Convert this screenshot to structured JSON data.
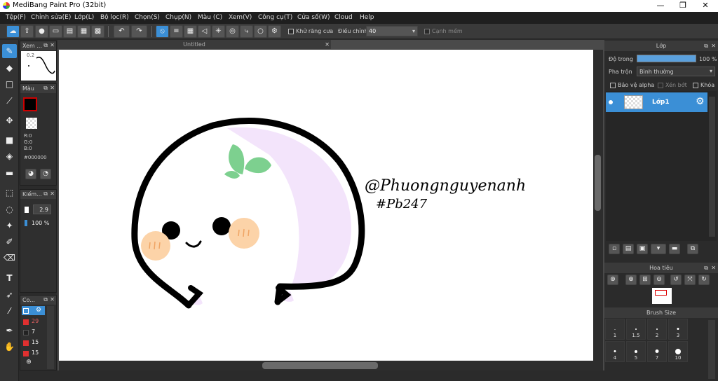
{
  "app": {
    "title": "MediBang Paint Pro (32bit)"
  },
  "window_controls": {
    "minimize": "—",
    "maximize": "❐",
    "close": "✕"
  },
  "menu": [
    "Tệp(F)",
    "Chỉnh sửa(E)",
    "Lớp(L)",
    "Bộ lọc(R)",
    "Chọn(S)",
    "Chụp(N)",
    "Màu (C)",
    "Xem(V)",
    "Công cụ(T)",
    "Cửa số(W)",
    "Cloud",
    "Help"
  ],
  "toolbar": {
    "antialias_label": "Khử răng cưa",
    "correction_label": "Điều chỉnh",
    "correction_value": "40",
    "edge_label": "Cạnh mềm"
  },
  "navigator_panel": {
    "title": "Xem ...",
    "zoom": "0.2"
  },
  "color_panel": {
    "title": "Màu",
    "r": "R:0",
    "g": "G:0",
    "b": "B:0",
    "hex": "#000000",
    "fg_color": "#000000"
  },
  "brush_panel": {
    "title": "Kiếm...",
    "size": "2.9",
    "opacity": "100 %"
  },
  "brush_list_panel": {
    "title": "Co...",
    "items": [
      {
        "value": "",
        "color": "#3b8fd6"
      },
      {
        "value": "29",
        "color": "#e03030"
      },
      {
        "value": "7",
        "color": "#222222"
      },
      {
        "value": "15",
        "color": "#e03030"
      },
      {
        "value": "15",
        "color": "#e03030"
      }
    ]
  },
  "canvas": {
    "tab_title": "Untitled"
  },
  "drawing": {
    "handle_text_1": "@Phuongnguyenanh",
    "handle_text_2": "#Pb247",
    "sprout_color": "#7dd08f",
    "shadow_color": "#f3e4fb",
    "cheek_color": "#fcd3a8"
  },
  "layer_panel": {
    "title": "Lớp",
    "opacity_label": "Độ trong",
    "opacity_value": "100 %",
    "blend_label": "Pha trộn",
    "blend_value": "Bình thường",
    "protect_alpha": "Bảo vệ alpha",
    "clip": "Xén bớt",
    "lock": "Khóa",
    "layer_name": "Lớp1"
  },
  "preview_panel": {
    "title": "Hoa tiêu"
  },
  "brush_size_panel": {
    "title": "Brush Size",
    "row1": [
      "1",
      "1.5",
      "2",
      "3"
    ],
    "row2": [
      "4",
      "5",
      "7",
      "10"
    ]
  }
}
